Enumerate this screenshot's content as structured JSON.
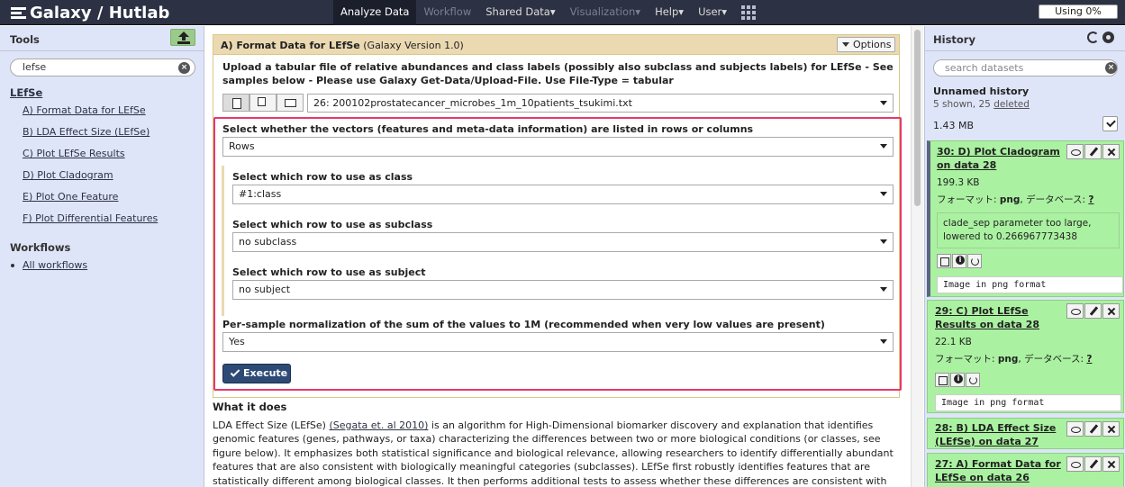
{
  "brand": {
    "title": "Galaxy / Hutlab"
  },
  "nav": {
    "items": [
      {
        "label": "Analyze Data",
        "state": "active"
      },
      {
        "label": "Workflow",
        "state": "disabled"
      },
      {
        "label": "Shared Data",
        "state": "normal",
        "caret": "▾"
      },
      {
        "label": "Visualization",
        "state": "disabled",
        "caret": "▾"
      },
      {
        "label": "Help",
        "state": "normal",
        "caret": "▾"
      },
      {
        "label": "User",
        "state": "normal",
        "caret": "▾"
      }
    ],
    "apps_icon": "grid-icon",
    "quota": "Using 0%"
  },
  "tools": {
    "title": "Tools",
    "upload_icon": "upload-icon",
    "search_value": "lefse",
    "section": "LEfSe",
    "links": [
      "A) Format Data for LEfSe",
      "B) LDA Effect Size (LEfSe)",
      "C) Plot LEfSe Results",
      "D) Plot Cladogram",
      "E) Plot One Feature",
      "F) Plot Differential Features"
    ],
    "workflows_title": "Workflows",
    "workflows_link": "All workflows"
  },
  "form": {
    "title": "A) Format Data for LEfSe",
    "version": "(Galaxy Version 1.0)",
    "options_label": "Options",
    "upload_note": "Upload a tabular file of relative abundances and class labels (possibly also subclass and subjects labels) for LEfSe - See samples below - Please use Galaxy Get-Data/Upload-File. Use File-Type = tabular",
    "dataset_value": "26: 200102prostatecancer_microbes_1m_10patients_tsukimi.txt",
    "q_rows_cols": "Select whether the vectors (features and meta-data information) are listed in rows or columns",
    "rows_cols_value": "Rows",
    "q_class": "Select which row to use as class",
    "class_value": "#1:class",
    "q_subclass": "Select which row to use as subclass",
    "subclass_value": "no subclass",
    "q_subject": "Select which row to use as subject",
    "subject_value": "no subject",
    "q_norm": "Per-sample normalization of the sum of the values to 1M (recommended when very low values are present)",
    "norm_value": "Yes",
    "execute_label": "Execute"
  },
  "help": {
    "title": "What it does",
    "pre": "LDA Effect Size (LEfSe) ",
    "cite": "(Segata et. al 2010)",
    "post": " is an algorithm for High-Dimensional biomarker discovery and explanation that identifies genomic features (genes, pathways, or taxa) characterizing the differences between two or more biological conditions (or classes, see figure below). It emphasizes both statistical significance and biological relevance, allowing researchers to identify differentially abundant features that are also consistent with biologically meaningful categories (subclasses). LEfSe first robustly identifies features that are statistically different among biological classes. It then performs additional tests to assess whether these differences are consistent with respect to expected biological"
  },
  "history": {
    "title": "History",
    "search_placeholder": "search datasets",
    "name": "Unnamed history",
    "shown": "5 shown, 25 ",
    "deleted_link": "deleted",
    "size": "1.43 MB",
    "items": [
      {
        "title": "30: D) Plot Cladogram on data 28",
        "size": "199.3 KB",
        "format_label": "フォーマット: ",
        "format": "png",
        "db_label": ", データベース: ",
        "db": "?",
        "info": "clade_sep parameter too large, lowered to 0.266967773438",
        "peek": "Image in png format"
      },
      {
        "title": "29: C) Plot LEfSe Results on data 28",
        "size": "22.1 KB",
        "format_label": "フォーマット: ",
        "format": "png",
        "db_label": ", データベース: ",
        "db": "?",
        "peek": "Image in png format"
      },
      {
        "title": "28: B) LDA Effect Size (LEfSe) on data 27"
      },
      {
        "title": "27: A) Format Data for LEfSe on data 26"
      }
    ]
  }
}
